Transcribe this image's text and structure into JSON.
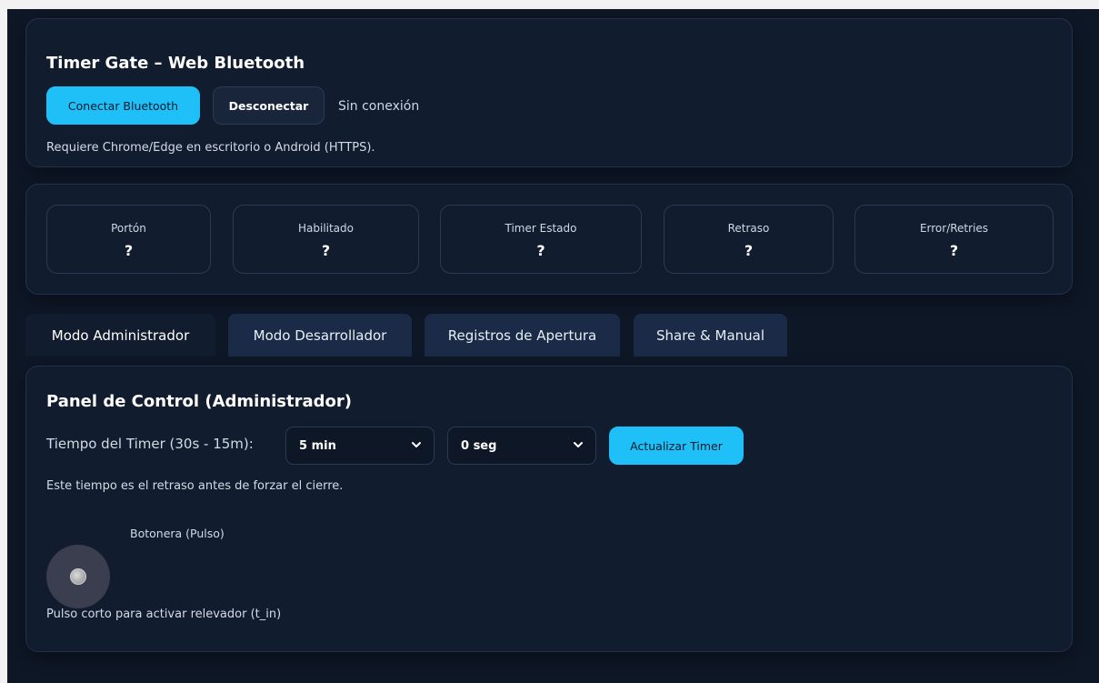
{
  "header": {
    "title": "Timer Gate – Web Bluetooth",
    "connect_label": "Conectar Bluetooth",
    "disconnect_label": "Desconectar",
    "connection_status": "Sin conexión",
    "requirement_note": "Requiere Chrome/Edge en escritorio o Android (HTTPS)."
  },
  "status": {
    "items": [
      {
        "label": "Portón",
        "value": "?"
      },
      {
        "label": "Habilitado",
        "value": "?"
      },
      {
        "label": "Timer Estado",
        "value": "?"
      },
      {
        "label": "Retraso",
        "value": "?"
      },
      {
        "label": "Error/Retries",
        "value": "?"
      }
    ]
  },
  "tabs": [
    {
      "label": "Modo Administrador",
      "active": true
    },
    {
      "label": "Modo Desarrollador",
      "active": false
    },
    {
      "label": "Registros de Apertura",
      "active": false
    },
    {
      "label": "Share & Manual",
      "active": false
    }
  ],
  "admin_panel": {
    "title": "Panel de Control (Administrador)",
    "timer_label": "Tiempo del Timer (30s - 15m):",
    "minutes_selected": "5 min",
    "seconds_selected": "0 seg",
    "update_label": "Actualizar Timer",
    "timer_note": "Este tiempo es el retraso antes de forzar el cierre.",
    "pulse_label": "Botonera (Pulso)",
    "pulse_note": "Pulso corto para activar relevador (t_in)"
  },
  "colors": {
    "accent": "#1ec0f7",
    "background": "#0e1726",
    "card": "#111c2e",
    "tab_inactive": "#1a2a47"
  }
}
